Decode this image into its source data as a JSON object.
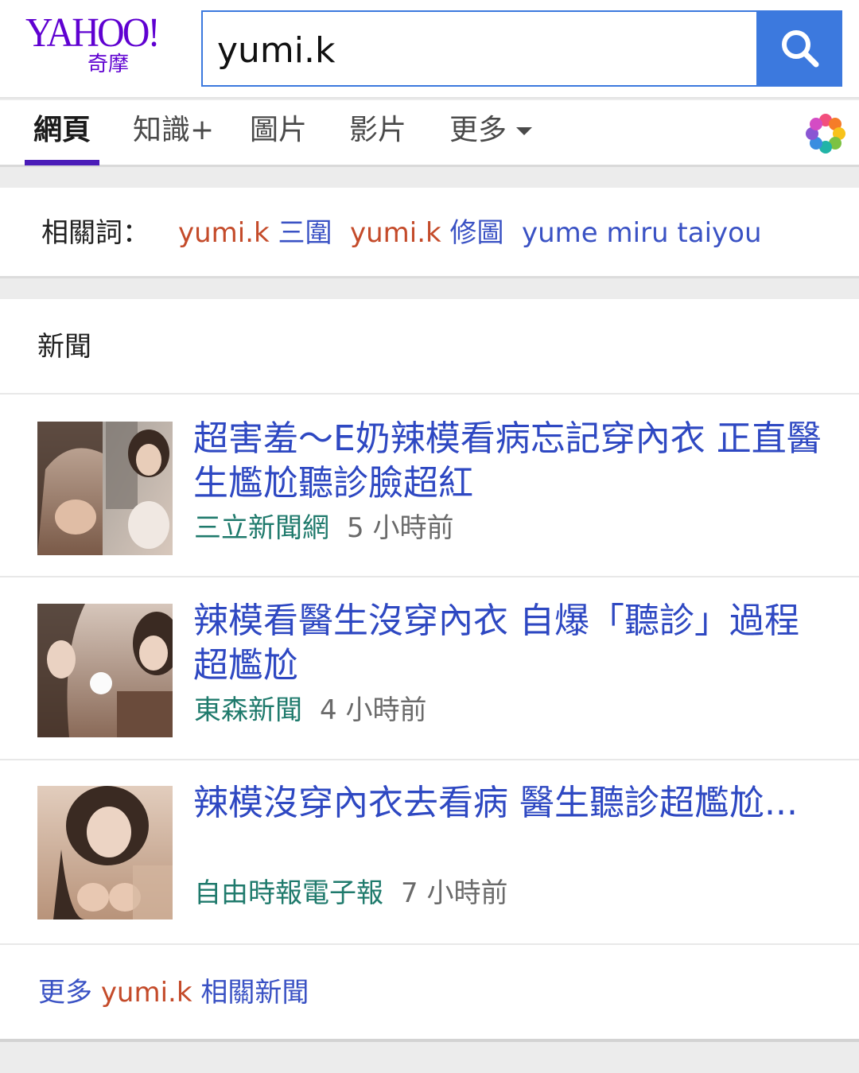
{
  "search": {
    "query": "yumi.k"
  },
  "logo": {
    "text": "YAHOO!",
    "subtext": "奇摩"
  },
  "tabs": [
    {
      "label": "網頁"
    },
    {
      "label": "知識+"
    },
    {
      "label": "圖片"
    },
    {
      "label": "影片"
    },
    {
      "label": "更多"
    }
  ],
  "related": {
    "label": "相關詞：",
    "items": [
      {
        "bold": "yumi.k",
        "rest": " 三圍"
      },
      {
        "bold": "yumi.k",
        "rest": " 修圖"
      },
      {
        "bold": "",
        "rest": "yume miru taiyou"
      }
    ]
  },
  "news": {
    "heading": "新聞",
    "items": [
      {
        "title": "超害羞～E奶辣模看病忘記穿內衣 正直醫生尷尬聽診臉超紅",
        "source": "三立新聞網",
        "time": "5 小時前"
      },
      {
        "title": "辣模看醫生沒穿內衣 自爆「聽診」過程超尷尬",
        "source": "東森新聞",
        "time": "4 小時前"
      },
      {
        "title": "辣模沒穿內衣去看病 醫生聽診超尷尬...",
        "source": "自由時報電子報",
        "time": "7 小時前"
      }
    ],
    "more": {
      "prefix": "更多 ",
      "query": "yumi.k",
      "suffix": " 相關新聞"
    }
  },
  "colors": {
    "accent": "#3c79de",
    "brand": "#5f01d1",
    "link": "#2e48c2",
    "source": "#1f7a6c"
  }
}
